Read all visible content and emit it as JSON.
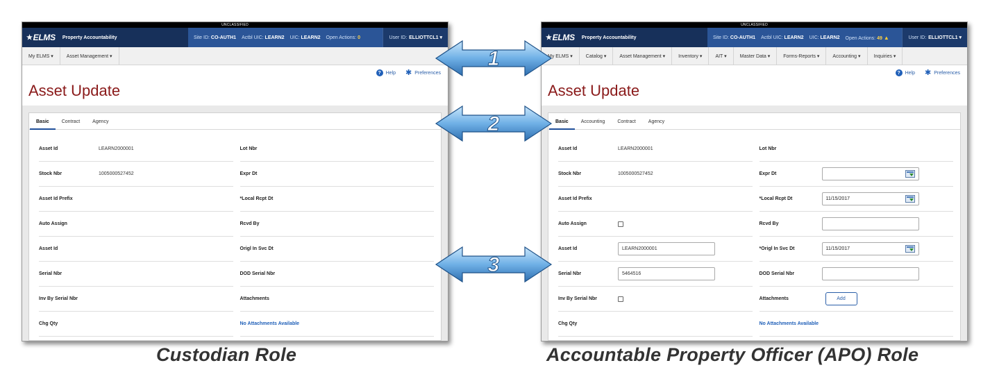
{
  "classification": "UNCLASSIFIED",
  "app": {
    "logo": "ELMS",
    "title": "Property Accountability"
  },
  "left": {
    "site_id_label": "Site ID:",
    "site_id": "CO-AUTH1",
    "actbl_uic_label": "Actbl UIC:",
    "actbl_uic": "LEARN2",
    "uic_label": "UIC:",
    "uic": "LEARN2",
    "open_actions_label": "Open Actions:",
    "open_actions": "0",
    "user_id_label": "User ID:",
    "user_id": "ELLIOTTCL1 ▾",
    "menu": [
      "My ELMS ▾",
      "Asset Management ▾"
    ],
    "help": "Help",
    "preferences": "Preferences",
    "page_title": "Asset Update",
    "tabs": [
      "Basic",
      "Contract",
      "Agency"
    ],
    "fields_left": [
      {
        "label": "Asset Id",
        "value": "LEARN2000001"
      },
      {
        "label": "Stock Nbr",
        "value": "1005000527452"
      },
      {
        "label": "Asset Id Prefix",
        "value": ""
      },
      {
        "label": "Auto Assign",
        "value": ""
      },
      {
        "label": "Asset Id",
        "value": ""
      },
      {
        "label": "Serial Nbr",
        "value": ""
      },
      {
        "label": "Inv By Serial Nbr",
        "value": ""
      },
      {
        "label": "Chg Qty",
        "value": ""
      }
    ],
    "fields_right": [
      {
        "label": "Lot Nbr"
      },
      {
        "label": "Expr Dt"
      },
      {
        "label": "*Local Rcpt Dt"
      },
      {
        "label": "Rcvd By"
      },
      {
        "label": "Origl In Svc Dt"
      },
      {
        "label": "DOD Serial Nbr"
      },
      {
        "label": "Attachments"
      },
      {
        "label": "No Attachments Available"
      }
    ]
  },
  "right": {
    "site_id_label": "Site ID:",
    "site_id": "CO-AUTH1",
    "actbl_uic_label": "Actbl UIC:",
    "actbl_uic": "LEARN2",
    "uic_label": "UIC:",
    "uic": "LEARN2",
    "open_actions_label": "Open Actions:",
    "open_actions": "49",
    "user_id_label": "User ID:",
    "user_id": "ELLIOTTCL1 ▾",
    "menu": [
      "My ELMS ▾",
      "Catalog ▾",
      "Asset Management ▾",
      "Inventory ▾",
      "AIT ▾",
      "Master Data ▾",
      "Forms-Reports ▾",
      "Accounting ▾",
      "Inquiries ▾"
    ],
    "help": "Help",
    "preferences": "Preferences",
    "page_title": "Asset Update",
    "tabs": [
      "Basic",
      "Accounting",
      "Contract",
      "Agency"
    ],
    "fields_left": {
      "asset_id": {
        "label": "Asset Id",
        "value": "LEARN2000001"
      },
      "stock_nbr": {
        "label": "Stock Nbr",
        "value": "1005000527452"
      },
      "asset_id_prefix": {
        "label": "Asset Id Prefix"
      },
      "auto_assign": {
        "label": "Auto Assign"
      },
      "asset_id_input": {
        "label": "Asset Id",
        "value": "LEARN2000001"
      },
      "serial_nbr": {
        "label": "Serial Nbr",
        "value": "5464516"
      },
      "inv_by_serial": {
        "label": "Inv By Serial Nbr"
      },
      "chg_qty": {
        "label": "Chg Qty"
      }
    },
    "fields_right": {
      "lot_nbr": {
        "label": "Lot Nbr"
      },
      "expr_dt": {
        "label": "Expr Dt",
        "value": ""
      },
      "local_rcpt_dt": {
        "label": "*Local Rcpt Dt",
        "value": "11/15/2017"
      },
      "rcvd_by": {
        "label": "Rcvd By",
        "value": ""
      },
      "origl_in_svc_dt": {
        "label": "*Origl In Svc Dt",
        "value": "11/15/2017"
      },
      "dod_serial_nbr": {
        "label": "DOD Serial Nbr",
        "value": ""
      },
      "attachments": {
        "label": "Attachments",
        "add_label": "Add"
      },
      "no_attachments": "No Attachments Available"
    }
  },
  "arrows": [
    "1",
    "2",
    "3"
  ],
  "captions": {
    "left": "Custodian Role",
    "right": "Accountable Property Officer (APO) Role"
  },
  "colors": {
    "arrow_fill": "#6fb0e6",
    "title_red": "#8a1a1a",
    "header_blue": "#1c3a6b"
  }
}
